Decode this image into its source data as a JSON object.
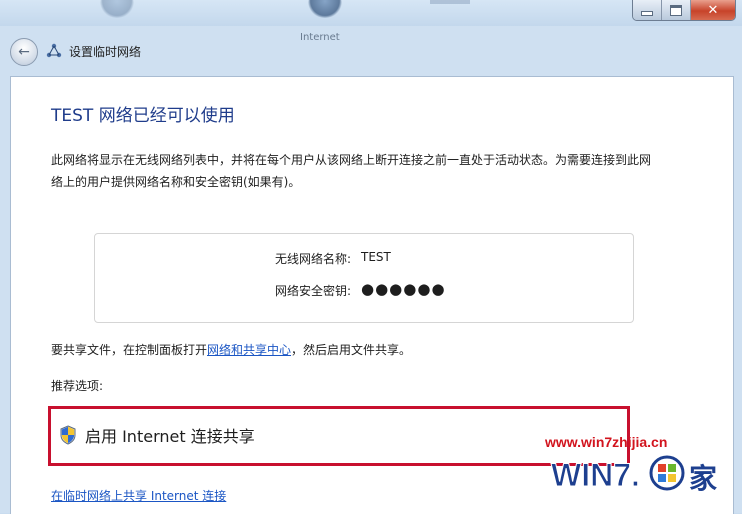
{
  "window": {
    "nav_title": "设置临时网络",
    "background_label": "Internet"
  },
  "content": {
    "heading": "TEST 网络已经可以使用",
    "description": "此网络将显示在无线网络列表中，并将在每个用户从该网络上断开连接之前一直处于活动状态。为需要连接到此网络上的用户提供网络名称和安全密钥(如果有)。",
    "network_name_label": "无线网络名称:",
    "network_name_value": "TEST",
    "security_key_label": "网络安全密钥:",
    "security_key_value": "●●●●●●",
    "share_prefix": "要共享文件，在控制面板打开",
    "share_link": "网络和共享中心",
    "share_suffix": "，然后启用文件共享。",
    "recommended_label": "推荐选项:",
    "ics_option": "启用 Internet 连接共享",
    "bottom_link": "在临时网络上共享 Internet 连接"
  },
  "watermark": {
    "url": "www.win7zhijia.cn",
    "logo_text": "WIN7.",
    "logo_char": "家"
  },
  "colors": {
    "heading": "#1f3c8b",
    "link": "#1b56c4",
    "highlight": "#c8102e"
  }
}
